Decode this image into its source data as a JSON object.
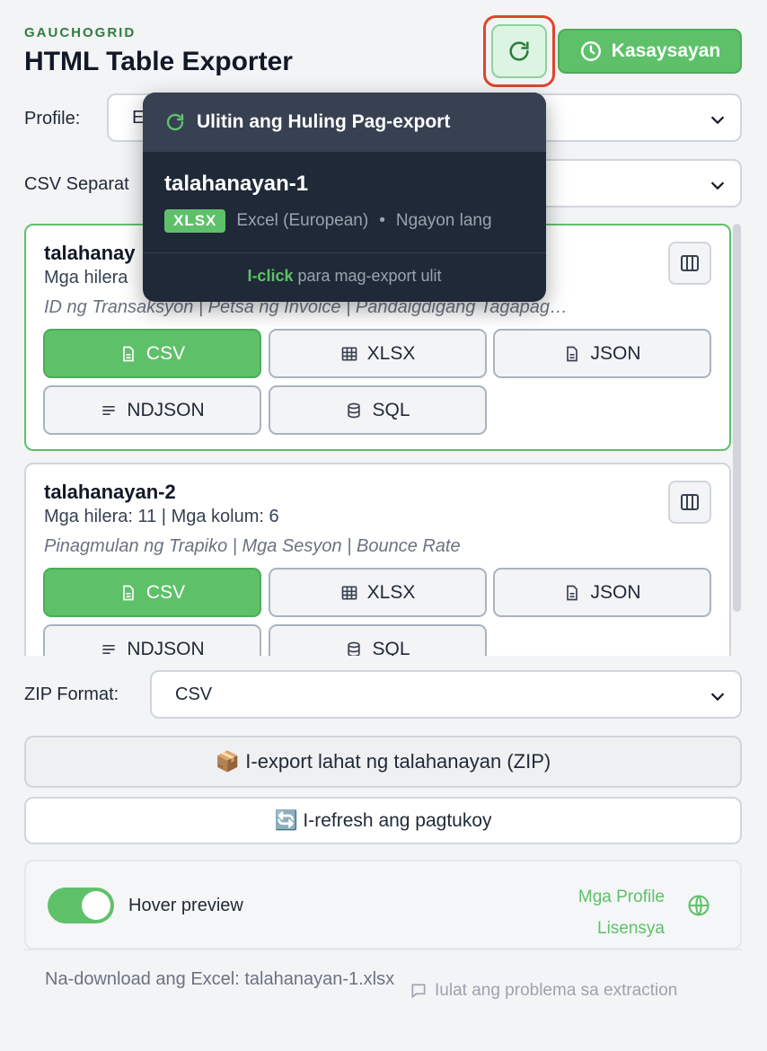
{
  "header": {
    "brand": "GAUCHOGRID",
    "title": "HTML Table Exporter",
    "history_label": "Kasaysayan"
  },
  "profile": {
    "label": "Profile:",
    "value": "E"
  },
  "separator": {
    "label": "CSV Separat"
  },
  "tables": [
    {
      "name": "talahanay",
      "meta": "Mga hilera",
      "columns": "ID ng Transaksyon | Petsa ng Invoice | Pandaigdigang Tagapag…",
      "formats": [
        "CSV",
        "XLSX",
        "JSON",
        "NDJSON",
        "SQL"
      ]
    },
    {
      "name": "talahanayan-2",
      "meta": "Mga hilera: 11 | Mga kolum: 6",
      "columns": "Pinagmulan ng Trapiko | Mga Sesyon | Bounce Rate",
      "formats": [
        "CSV",
        "XLSX",
        "JSON",
        "NDJSON",
        "SQL"
      ]
    }
  ],
  "zip": {
    "label": "ZIP Format:",
    "value": "CSV"
  },
  "actions": {
    "export_all": "📦 I-export lahat ng talahanayan (ZIP)",
    "refresh": "🔄 I-refresh ang pagtukoy"
  },
  "footer": {
    "hover_preview": "Hover preview",
    "profiles_link": "Mga Profile",
    "license_link": "Lisensya",
    "status": "Na-download ang Excel: talahanayan-1.xlsx",
    "report": "Iulat ang problema sa extraction"
  },
  "popup": {
    "title": "Ulitin ang Huling Pag-export",
    "table_name": "talahanayan-1",
    "format_badge": "XLSX",
    "profile": "Excel (European)",
    "dot": "•",
    "time": "Ngayon lang",
    "hint_action": "I-click",
    "hint_rest": " para mag-export ulit"
  },
  "colors": {
    "accent": "#5ec16a",
    "brand": "#2f7d3e",
    "highlight": "#e0452b",
    "popup_bg": "#1f2937"
  }
}
